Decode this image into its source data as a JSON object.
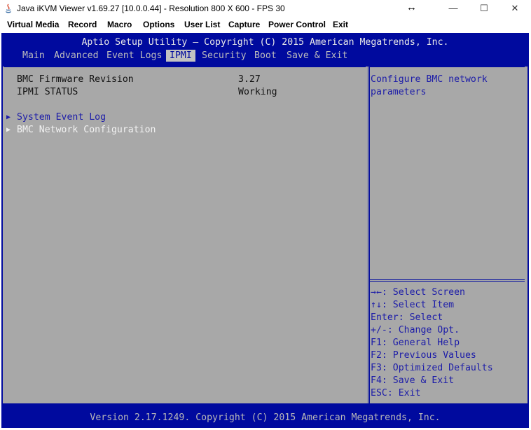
{
  "window": {
    "title": "Java iKVM Viewer v1.69.27 [10.0.0.44]  - Resolution 800 X 600 - FPS 30",
    "minimize_glyph": "—",
    "maximize_glyph": "☐",
    "close_glyph": "✕",
    "resize_glyph": "↔"
  },
  "menubar": [
    {
      "label": "Virtual Media"
    },
    {
      "label": "Record"
    },
    {
      "label": "Macro"
    },
    {
      "label": "Options"
    },
    {
      "label": "User List"
    },
    {
      "label": "Capture"
    },
    {
      "label": "Power Control"
    },
    {
      "label": "Exit"
    }
  ],
  "bios": {
    "title": "Aptio Setup Utility – Copyright (C) 2015 American Megatrends, Inc.",
    "tabs": [
      {
        "label": "Main",
        "active": false
      },
      {
        "label": "Advanced",
        "active": false
      },
      {
        "label": "Event Logs",
        "active": false
      },
      {
        "label": "IPMI",
        "active": true
      },
      {
        "label": "Security",
        "active": false
      },
      {
        "label": "Boot",
        "active": false
      },
      {
        "label": "Save & Exit",
        "active": false
      }
    ],
    "info": [
      {
        "label": "BMC Firmware Revision",
        "value": "3.27"
      },
      {
        "label": "IPMI STATUS",
        "value": "Working"
      }
    ],
    "submenus": [
      {
        "label": "System Event Log",
        "selected": false
      },
      {
        "label": "BMC Network Configuration",
        "selected": true
      }
    ],
    "help_text": [
      "Configure BMC network",
      "parameters"
    ],
    "keys": [
      "→←: Select Screen",
      "↑↓: Select Item",
      "Enter: Select",
      "+/-: Change Opt.",
      "F1: General Help",
      "F2: Previous Values",
      "F3: Optimized Defaults",
      "F4: Save & Exit",
      "ESC: Exit"
    ],
    "footer": "Version 2.17.1249. Copyright (C) 2015 American Megatrends, Inc."
  },
  "colors": {
    "bios_blue": "#000a9e",
    "panel_gray": "#a8a8a8",
    "active_tab_bg": "#c2c2c2"
  }
}
